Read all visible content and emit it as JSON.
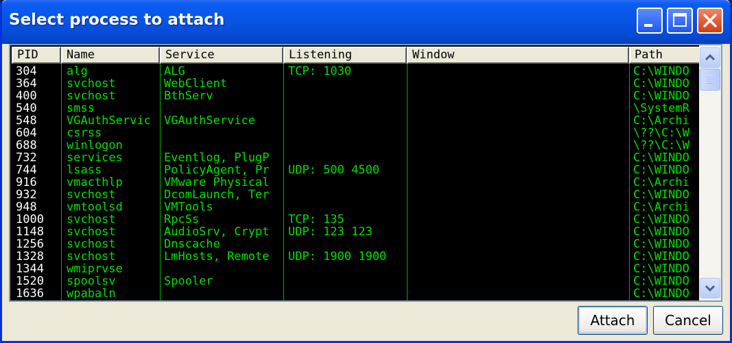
{
  "window": {
    "title": "Select process to attach"
  },
  "columns": {
    "pid": "PID",
    "name": "Name",
    "service": "Service",
    "listening": "Listening",
    "window": "Window",
    "path": "Path"
  },
  "processes": [
    {
      "pid": "304",
      "name": "alg",
      "service": "ALG",
      "listening": "TCP: 1030",
      "window": "",
      "path": "C:\\WINDO"
    },
    {
      "pid": "364",
      "name": "svchost",
      "service": "WebClient",
      "listening": "",
      "window": "",
      "path": "C:\\WINDO"
    },
    {
      "pid": "400",
      "name": "svchost",
      "service": "BthServ",
      "listening": "",
      "window": "",
      "path": "C:\\WINDO"
    },
    {
      "pid": "540",
      "name": "smss",
      "service": "",
      "listening": "",
      "window": "",
      "path": "\\SystemR"
    },
    {
      "pid": "548",
      "name": "VGAuthServic",
      "service": "VGAuthService",
      "listening": "",
      "window": "",
      "path": "C:\\Archi"
    },
    {
      "pid": "604",
      "name": "csrss",
      "service": "",
      "listening": "",
      "window": "",
      "path": "\\??\\C:\\W"
    },
    {
      "pid": "688",
      "name": "winlogon",
      "service": "",
      "listening": "",
      "window": "",
      "path": "\\??\\C:\\W"
    },
    {
      "pid": "732",
      "name": "services",
      "service": "Eventlog, PlugP",
      "listening": "",
      "window": "",
      "path": "C:\\WINDO"
    },
    {
      "pid": "744",
      "name": "lsass",
      "service": "PolicyAgent, Pr",
      "listening": "UDP: 500 4500",
      "window": "",
      "path": "C:\\WINDO"
    },
    {
      "pid": "916",
      "name": "vmacthlp",
      "service": "VMware Physical",
      "listening": "",
      "window": "",
      "path": "C:\\Archi"
    },
    {
      "pid": "932",
      "name": "svchost",
      "service": "DcomLaunch, Ter",
      "listening": "",
      "window": "",
      "path": "C:\\WINDO"
    },
    {
      "pid": "948",
      "name": "vmtoolsd",
      "service": "VMTools",
      "listening": "",
      "window": "",
      "path": "C:\\Archi"
    },
    {
      "pid": "1000",
      "name": "svchost",
      "service": "RpcSs",
      "listening": "TCP: 135",
      "window": "",
      "path": "C:\\WINDO"
    },
    {
      "pid": "1148",
      "name": "svchost",
      "service": "AudioSrv, Crypt",
      "listening": "UDP: 123 123",
      "window": "",
      "path": "C:\\WINDO"
    },
    {
      "pid": "1256",
      "name": "svchost",
      "service": "Dnscache",
      "listening": "",
      "window": "",
      "path": "C:\\WINDO"
    },
    {
      "pid": "1328",
      "name": "svchost",
      "service": "LmHosts, Remote",
      "listening": "UDP: 1900 1900",
      "window": "",
      "path": "C:\\WINDO"
    },
    {
      "pid": "1344",
      "name": "wmiprvse",
      "service": "",
      "listening": "",
      "window": "",
      "path": "C:\\WINDO"
    },
    {
      "pid": "1520",
      "name": "spoolsv",
      "service": "Spooler",
      "listening": "",
      "window": "",
      "path": "C:\\WINDO"
    },
    {
      "pid": "1636",
      "name": "wpabaln",
      "service": "",
      "listening": "",
      "window": "",
      "path": "C:\\WINDO"
    }
  ],
  "buttons": {
    "attach": "Attach",
    "cancel": "Cancel"
  },
  "colors": {
    "titlebar": "#0054e3",
    "list_bg": "#000000",
    "pid_text": "#ffffff",
    "data_text": "#00e000",
    "dialog_bg": "#ece9d8"
  },
  "icons": {
    "minimize": "minimize-icon",
    "maximize": "maximize-icon",
    "close": "close-icon",
    "scroll_up": "scroll-up-arrow-icon",
    "scroll_down": "scroll-down-arrow-icon"
  }
}
